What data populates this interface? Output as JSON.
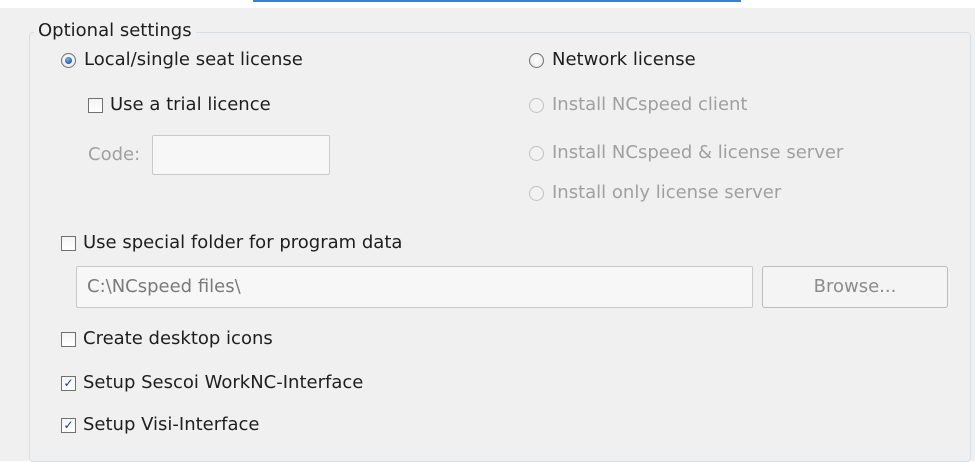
{
  "group": {
    "title": "Optional settings"
  },
  "license": {
    "local": {
      "label": "Local/single seat license",
      "checked": true
    },
    "network": {
      "label": "Network license",
      "checked": false
    },
    "trial": {
      "label": "Use a trial licence",
      "checked": false
    },
    "code": {
      "label": "Code:",
      "value": ""
    },
    "network_options": [
      {
        "label": "Install NCspeed client",
        "enabled": false
      },
      {
        "label": "Install NCspeed & license server",
        "enabled": false
      },
      {
        "label": "Install only license server",
        "enabled": false
      }
    ]
  },
  "program_data": {
    "label": "Use special folder for program data",
    "checked": false,
    "folder_value": "C:\\NCspeed files\\",
    "browse_label": "Browse..."
  },
  "options": [
    {
      "label": "Create desktop icons",
      "checked": false
    },
    {
      "label": "Setup Sescoi WorkNC-Interface",
      "checked": true
    },
    {
      "label": "Setup Visi-Interface",
      "checked": true
    }
  ],
  "colors": {
    "accent": "#3c7fd4",
    "panel_bg": "#f0f0f0",
    "disabled_text": "#a0a0a0"
  }
}
